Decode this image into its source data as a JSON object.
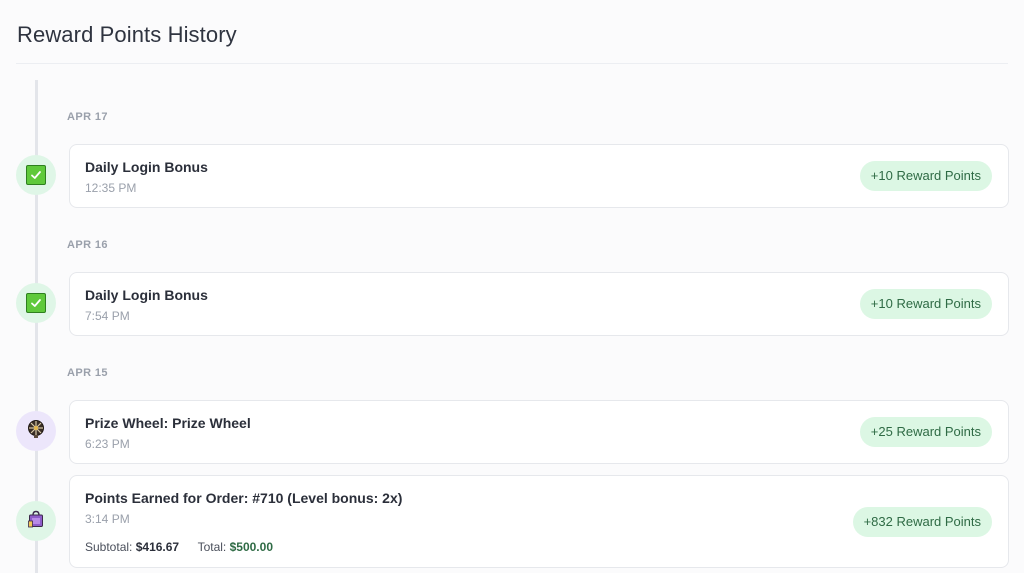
{
  "page": {
    "title": "Reward Points History"
  },
  "groups": [
    {
      "date": "APR 17",
      "entries": [
        {
          "icon": "check-icon",
          "title": "Daily Login Bonus",
          "time": "12:35 PM",
          "points": "+10 Reward Points"
        }
      ]
    },
    {
      "date": "APR 16",
      "entries": [
        {
          "icon": "check-icon",
          "title": "Daily Login Bonus",
          "time": "7:54 PM",
          "points": "+10 Reward Points"
        }
      ]
    },
    {
      "date": "APR 15",
      "entries": [
        {
          "icon": "prize-wheel-icon",
          "title": "Prize Wheel: Prize Wheel",
          "time": "6:23 PM",
          "points": "+25 Reward Points"
        },
        {
          "icon": "shopping-bag-icon",
          "title": "Points Earned for Order: #710 (Level bonus: 2x)",
          "time": "3:14 PM",
          "points": "+832 Reward Points",
          "subtotal_label": "Subtotal:",
          "subtotal_value": "$416.67",
          "total_label": "Total:",
          "total_value": "$500.00"
        }
      ]
    }
  ],
  "colors": {
    "badge_bg": "#dcf7e4",
    "badge_text": "#2f6b45",
    "dot_green": "#dff6e7",
    "dot_purple": "#ece6fb"
  }
}
